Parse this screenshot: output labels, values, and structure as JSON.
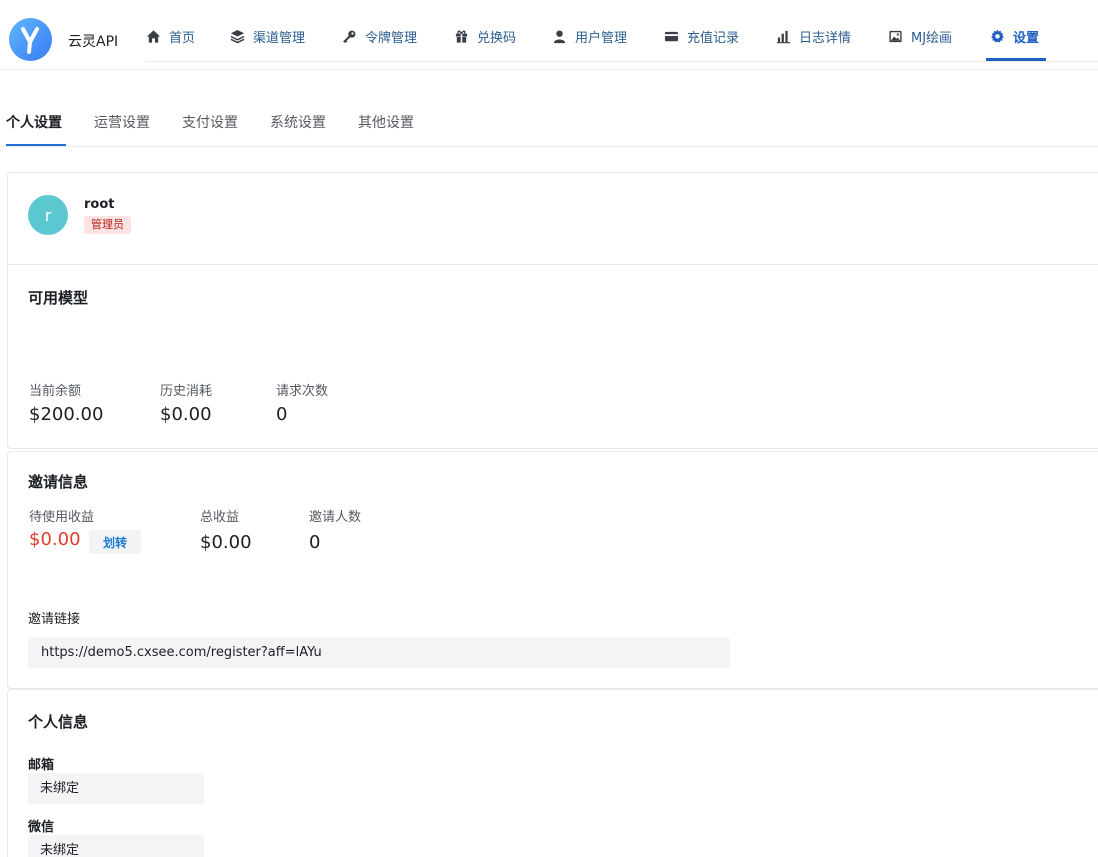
{
  "app": {
    "brand": "云灵API"
  },
  "nav": {
    "items": [
      {
        "label": "首页",
        "icon": "home-icon"
      },
      {
        "label": "渠道管理",
        "icon": "layers-icon"
      },
      {
        "label": "令牌管理",
        "icon": "key-icon"
      },
      {
        "label": "兑换码",
        "icon": "gift-icon"
      },
      {
        "label": "用户管理",
        "icon": "user-icon"
      },
      {
        "label": "充值记录",
        "icon": "credit-card-icon"
      },
      {
        "label": "日志详情",
        "icon": "bar-chart-icon"
      },
      {
        "label": "MJ绘画",
        "icon": "image-icon"
      },
      {
        "label": "设置",
        "icon": "gear-icon",
        "active": true
      }
    ]
  },
  "subtabs": [
    "个人设置",
    "运营设置",
    "支付设置",
    "系统设置",
    "其他设置"
  ],
  "user": {
    "avatar_letter": "r",
    "name": "root",
    "role": "管理员"
  },
  "models": {
    "title": "可用模型",
    "stats": [
      {
        "label": "当前余额",
        "value": "$200.00"
      },
      {
        "label": "历史消耗",
        "value": "$0.00"
      },
      {
        "label": "请求次数",
        "value": "0"
      }
    ]
  },
  "invite": {
    "title": "邀请信息",
    "pending_label": "待使用收益",
    "pending_value": "$0.00",
    "transfer_label": "划转",
    "total_label": "总收益",
    "total_value": "$0.00",
    "count_label": "邀请人数",
    "count_value": "0",
    "link_label": "邀请链接",
    "link_value": "https://demo5.cxsee.com/register?aff=lAYu"
  },
  "profile": {
    "title": "个人信息",
    "email_label": "邮箱",
    "email_value": "未绑定",
    "wechat_label": "微信",
    "wechat_value": "未绑定"
  },
  "colors": {
    "accent": "#1f5fc4",
    "nav_text": "#2a5d8f",
    "danger": "#e03c2c",
    "badge_bg": "#fde2e2"
  }
}
